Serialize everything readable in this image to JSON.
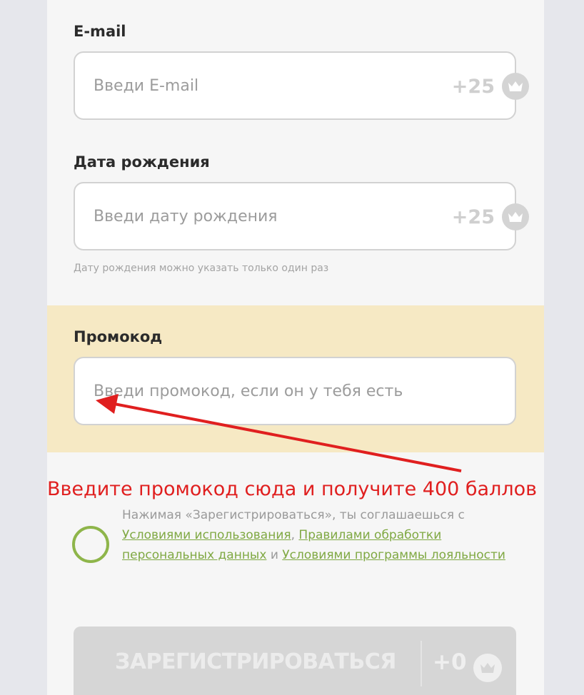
{
  "form": {
    "email": {
      "label": "E-mail",
      "placeholder": "Введи E-mail",
      "bonus": "+25",
      "bonus_icon": "crown-coin-icon"
    },
    "birthdate": {
      "label": "Дата рождения",
      "placeholder": "Введи дату рождения",
      "bonus": "+25",
      "bonus_icon": "crown-coin-icon",
      "hint": "Дату рождения можно указать только один раз"
    },
    "promo": {
      "label": "Промокод",
      "placeholder": "Введи промокод, если он у тебя есть"
    },
    "consent": {
      "text_prefix": "Нажимая «Зарегистрироваться», ты соглашаешься с ",
      "link_terms": "Условиями использования",
      "separator": ", ",
      "link_privacy": "Правилами обработки персональных данных",
      "and": " и ",
      "link_loyalty": "Условиями программы лояльности"
    },
    "submit": {
      "label": "ЗАРЕГИСТРИРОВАТЬСЯ",
      "bonus": "+0",
      "bonus_icon": "crown-coin-icon"
    }
  },
  "annotation": {
    "text": "Введите промокод сюда и получите 400 баллов",
    "color": "#e01f1f"
  },
  "colors": {
    "accent_green": "#8eb54a",
    "promo_background": "#f6e9c4",
    "disabled_button": "#d6d6d6"
  }
}
